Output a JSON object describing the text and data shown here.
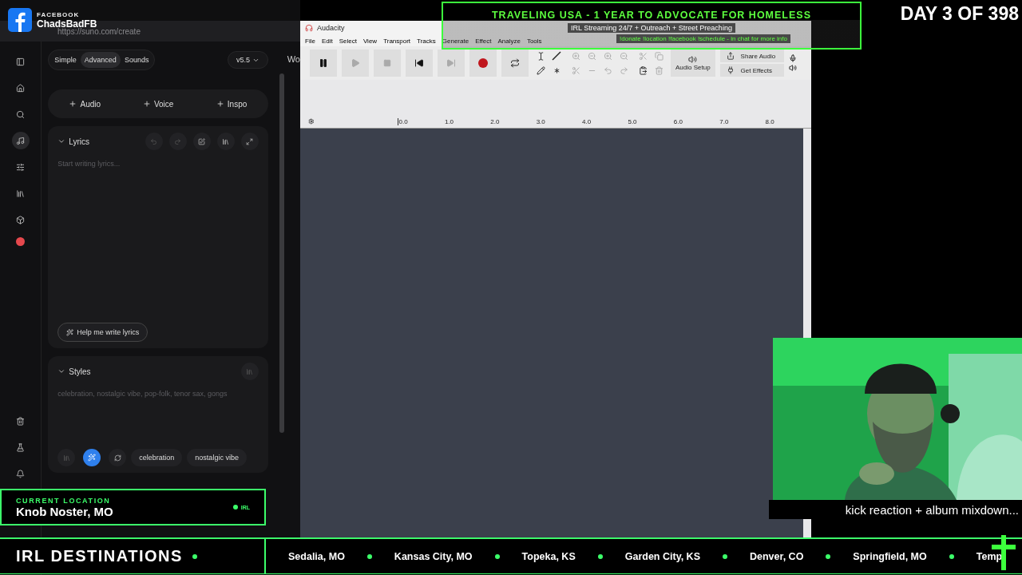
{
  "browser": {
    "url": "https://suno.com/create"
  },
  "suno": {
    "mode_tabs": [
      {
        "label": "Simple",
        "selected": false
      },
      {
        "label": "Advanced",
        "selected": true
      },
      {
        "label": "Sounds",
        "selected": false
      }
    ],
    "version": "v5.5",
    "add_buttons": [
      "Audio",
      "Voice",
      "Inspo"
    ],
    "lyrics": {
      "title": "Lyrics",
      "placeholder": "Start writing lyrics...",
      "help_button": "Help me write lyrics"
    },
    "styles": {
      "title": "Styles",
      "placeholder": "celebration, nostalgic vibe, pop-folk, tenor sax, gongs",
      "chips": [
        "celebration",
        "nostalgic vibe"
      ]
    },
    "side_panel_heading": "Wo"
  },
  "audacity": {
    "title": "Audacity",
    "menu": [
      "File",
      "Edit",
      "Select",
      "View",
      "Transport",
      "Tracks",
      "Generate",
      "Effect",
      "Analyze",
      "Tools"
    ],
    "audio_setup": "Audio Setup",
    "share_audio": "Share Audio",
    "get_effects": "Get Effects",
    "ruler_ticks": [
      "0.0",
      "1.0",
      "2.0",
      "3.0",
      "4.0",
      "5.0",
      "6.0",
      "7.0",
      "8.0"
    ]
  },
  "overlay": {
    "facebook": {
      "label": "FACEBOOK",
      "name": "ChadsBadFB"
    },
    "banner": {
      "title": "TRAVELING USA - 1 YEAR TO ADVOCATE FOR HOMELESS",
      "subtitle": "IRL Streaming 24/7 + Outreach + Street Preaching",
      "commands": "!donate !location !facebook !schedule - in chat for more info"
    },
    "day_counter": "DAY 3 OF 398",
    "caption": "kick reaction + album mixdown...",
    "location": {
      "label": "CURRENT LOCATION",
      "place": "Knob Noster, MO",
      "badge": "IRL"
    },
    "destinations": {
      "title": "IRL DESTINATIONS",
      "places": [
        "Sedalia, MO",
        "Kansas City, MO",
        "Topeka, KS",
        "Garden City, KS",
        "Denver, CO",
        "Springfield, MO",
        "Temp"
      ]
    }
  }
}
